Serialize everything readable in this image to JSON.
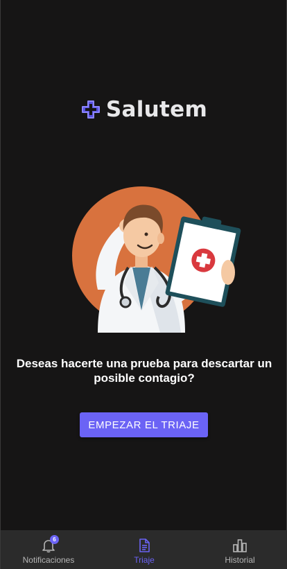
{
  "brand": {
    "name": "Salutem",
    "accent_color": "#6b63f5"
  },
  "main": {
    "question": "Deseas hacerte una prueba para descartar un posible contagio?",
    "cta_label": "EMPEZAR EL TRIAJE",
    "illustration": "doctor-with-clipboard-illustration"
  },
  "bottom_nav": {
    "items": [
      {
        "label": "Notificaciones",
        "icon": "bell-icon",
        "badge": "6",
        "active": false
      },
      {
        "label": "Triaje",
        "icon": "document-icon",
        "active": true
      },
      {
        "label": "Historial",
        "icon": "bar-chart-icon",
        "active": false
      }
    ]
  }
}
